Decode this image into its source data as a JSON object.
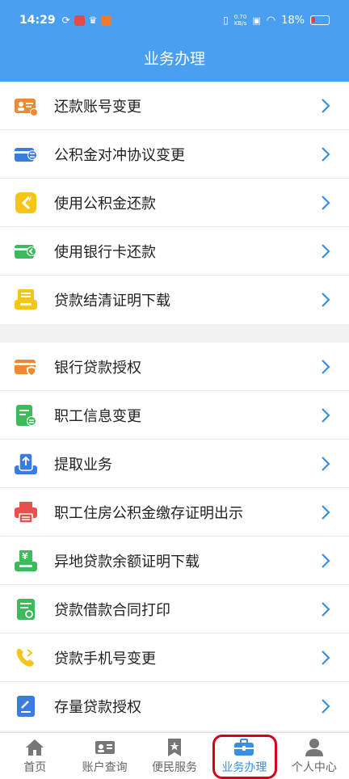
{
  "status": {
    "time": "14:29",
    "net_top": "0.70",
    "net_bottom": "KB/s",
    "battery": "18%"
  },
  "header": {
    "title": "业务办理"
  },
  "group1": [
    {
      "label": "还款账号变更",
      "icon": "card-person-icon"
    },
    {
      "label": "公积金对冲协议变更",
      "icon": "card-transfer-icon"
    },
    {
      "label": "使用公积金还款",
      "icon": "yuan-return-icon"
    },
    {
      "label": "使用银行卡还款",
      "icon": "card-arrow-icon"
    },
    {
      "label": "贷款结清证明下载",
      "icon": "document-tray-icon"
    }
  ],
  "group2": [
    {
      "label": "银行贷款授权",
      "icon": "card-shield-icon"
    },
    {
      "label": "职工信息变更",
      "icon": "document-edit-icon"
    },
    {
      "label": "提取业务",
      "icon": "phone-upload-icon"
    },
    {
      "label": "职工住房公积金缴存证明出示",
      "icon": "printer-icon"
    },
    {
      "label": "异地贷款余额证明下载",
      "icon": "yuan-printer-icon"
    },
    {
      "label": "贷款借款合同打印",
      "icon": "contract-icon"
    },
    {
      "label": "贷款手机号变更",
      "icon": "phone-call-icon"
    },
    {
      "label": "存量贷款授权",
      "icon": "pen-document-icon"
    }
  ],
  "tabs": [
    {
      "label": "首页",
      "icon": "home-icon"
    },
    {
      "label": "账户查询",
      "icon": "id-card-icon"
    },
    {
      "label": "便民服务",
      "icon": "bookmark-star-icon"
    },
    {
      "label": "业务办理",
      "icon": "briefcase-icon"
    },
    {
      "label": "个人中心",
      "icon": "person-icon"
    }
  ],
  "colors": {
    "header": "#4a9ff0",
    "active_tab": "#3a8ee6",
    "chevron": "#3a8ee6",
    "highlight": "#d0021b"
  }
}
